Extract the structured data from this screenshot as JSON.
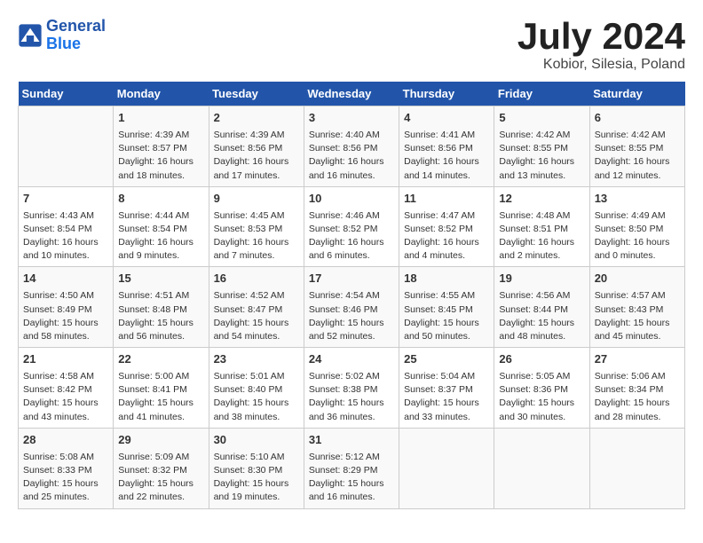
{
  "header": {
    "logo_line1": "General",
    "logo_line2": "Blue",
    "month_year": "July 2024",
    "location": "Kobior, Silesia, Poland"
  },
  "weekdays": [
    "Sunday",
    "Monday",
    "Tuesday",
    "Wednesday",
    "Thursday",
    "Friday",
    "Saturday"
  ],
  "weeks": [
    [
      {
        "day": "",
        "info": ""
      },
      {
        "day": "1",
        "info": "Sunrise: 4:39 AM\nSunset: 8:57 PM\nDaylight: 16 hours\nand 18 minutes."
      },
      {
        "day": "2",
        "info": "Sunrise: 4:39 AM\nSunset: 8:56 PM\nDaylight: 16 hours\nand 17 minutes."
      },
      {
        "day": "3",
        "info": "Sunrise: 4:40 AM\nSunset: 8:56 PM\nDaylight: 16 hours\nand 16 minutes."
      },
      {
        "day": "4",
        "info": "Sunrise: 4:41 AM\nSunset: 8:56 PM\nDaylight: 16 hours\nand 14 minutes."
      },
      {
        "day": "5",
        "info": "Sunrise: 4:42 AM\nSunset: 8:55 PM\nDaylight: 16 hours\nand 13 minutes."
      },
      {
        "day": "6",
        "info": "Sunrise: 4:42 AM\nSunset: 8:55 PM\nDaylight: 16 hours\nand 12 minutes."
      }
    ],
    [
      {
        "day": "7",
        "info": "Sunrise: 4:43 AM\nSunset: 8:54 PM\nDaylight: 16 hours\nand 10 minutes."
      },
      {
        "day": "8",
        "info": "Sunrise: 4:44 AM\nSunset: 8:54 PM\nDaylight: 16 hours\nand 9 minutes."
      },
      {
        "day": "9",
        "info": "Sunrise: 4:45 AM\nSunset: 8:53 PM\nDaylight: 16 hours\nand 7 minutes."
      },
      {
        "day": "10",
        "info": "Sunrise: 4:46 AM\nSunset: 8:52 PM\nDaylight: 16 hours\nand 6 minutes."
      },
      {
        "day": "11",
        "info": "Sunrise: 4:47 AM\nSunset: 8:52 PM\nDaylight: 16 hours\nand 4 minutes."
      },
      {
        "day": "12",
        "info": "Sunrise: 4:48 AM\nSunset: 8:51 PM\nDaylight: 16 hours\nand 2 minutes."
      },
      {
        "day": "13",
        "info": "Sunrise: 4:49 AM\nSunset: 8:50 PM\nDaylight: 16 hours\nand 0 minutes."
      }
    ],
    [
      {
        "day": "14",
        "info": "Sunrise: 4:50 AM\nSunset: 8:49 PM\nDaylight: 15 hours\nand 58 minutes."
      },
      {
        "day": "15",
        "info": "Sunrise: 4:51 AM\nSunset: 8:48 PM\nDaylight: 15 hours\nand 56 minutes."
      },
      {
        "day": "16",
        "info": "Sunrise: 4:52 AM\nSunset: 8:47 PM\nDaylight: 15 hours\nand 54 minutes."
      },
      {
        "day": "17",
        "info": "Sunrise: 4:54 AM\nSunset: 8:46 PM\nDaylight: 15 hours\nand 52 minutes."
      },
      {
        "day": "18",
        "info": "Sunrise: 4:55 AM\nSunset: 8:45 PM\nDaylight: 15 hours\nand 50 minutes."
      },
      {
        "day": "19",
        "info": "Sunrise: 4:56 AM\nSunset: 8:44 PM\nDaylight: 15 hours\nand 48 minutes."
      },
      {
        "day": "20",
        "info": "Sunrise: 4:57 AM\nSunset: 8:43 PM\nDaylight: 15 hours\nand 45 minutes."
      }
    ],
    [
      {
        "day": "21",
        "info": "Sunrise: 4:58 AM\nSunset: 8:42 PM\nDaylight: 15 hours\nand 43 minutes."
      },
      {
        "day": "22",
        "info": "Sunrise: 5:00 AM\nSunset: 8:41 PM\nDaylight: 15 hours\nand 41 minutes."
      },
      {
        "day": "23",
        "info": "Sunrise: 5:01 AM\nSunset: 8:40 PM\nDaylight: 15 hours\nand 38 minutes."
      },
      {
        "day": "24",
        "info": "Sunrise: 5:02 AM\nSunset: 8:38 PM\nDaylight: 15 hours\nand 36 minutes."
      },
      {
        "day": "25",
        "info": "Sunrise: 5:04 AM\nSunset: 8:37 PM\nDaylight: 15 hours\nand 33 minutes."
      },
      {
        "day": "26",
        "info": "Sunrise: 5:05 AM\nSunset: 8:36 PM\nDaylight: 15 hours\nand 30 minutes."
      },
      {
        "day": "27",
        "info": "Sunrise: 5:06 AM\nSunset: 8:34 PM\nDaylight: 15 hours\nand 28 minutes."
      }
    ],
    [
      {
        "day": "28",
        "info": "Sunrise: 5:08 AM\nSunset: 8:33 PM\nDaylight: 15 hours\nand 25 minutes."
      },
      {
        "day": "29",
        "info": "Sunrise: 5:09 AM\nSunset: 8:32 PM\nDaylight: 15 hours\nand 22 minutes."
      },
      {
        "day": "30",
        "info": "Sunrise: 5:10 AM\nSunset: 8:30 PM\nDaylight: 15 hours\nand 19 minutes."
      },
      {
        "day": "31",
        "info": "Sunrise: 5:12 AM\nSunset: 8:29 PM\nDaylight: 15 hours\nand 16 minutes."
      },
      {
        "day": "",
        "info": ""
      },
      {
        "day": "",
        "info": ""
      },
      {
        "day": "",
        "info": ""
      }
    ]
  ]
}
